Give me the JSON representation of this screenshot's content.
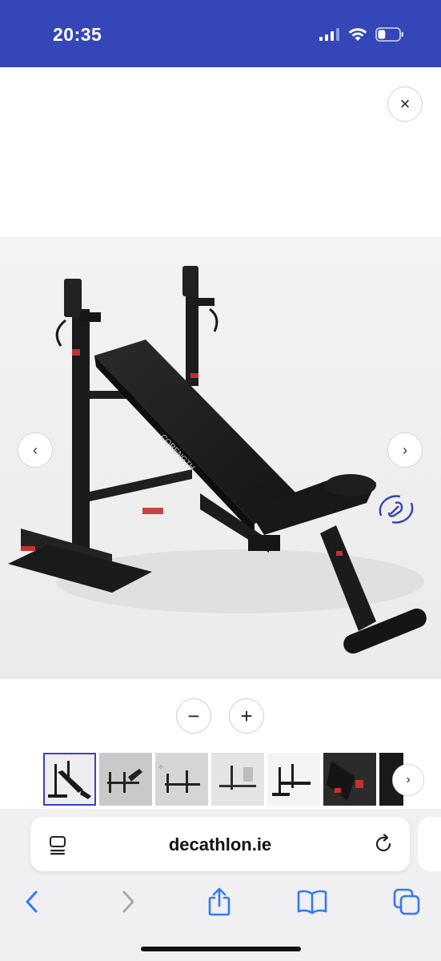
{
  "status_bar": {
    "time": "20:35",
    "battery_level": 0.35
  },
  "close_button": {
    "label": "×",
    "icon": "close-icon"
  },
  "gallery": {
    "main_image": "weight-bench-image",
    "brand_on_seat": "CORENGTH",
    "ar_icon": "ar-view-icon",
    "prev_label": "‹",
    "next_label": "›"
  },
  "zoom": {
    "minus_label": "−",
    "plus_label": "+"
  },
  "thumbnails": {
    "items": [
      "bench-incline",
      "bench-side-1",
      "bench-side-2",
      "bench-lifestyle",
      "bench-flat",
      "bench-detail-red",
      "bench-detail-dark"
    ],
    "active_index": 0,
    "next_label": "›"
  },
  "browser": {
    "url": "decathlon.ie",
    "accent": "#3478f6"
  },
  "colors": {
    "status_bar": "#3446b8",
    "brand_blue": "#3643ba",
    "accent_red": "#d23a3a"
  }
}
